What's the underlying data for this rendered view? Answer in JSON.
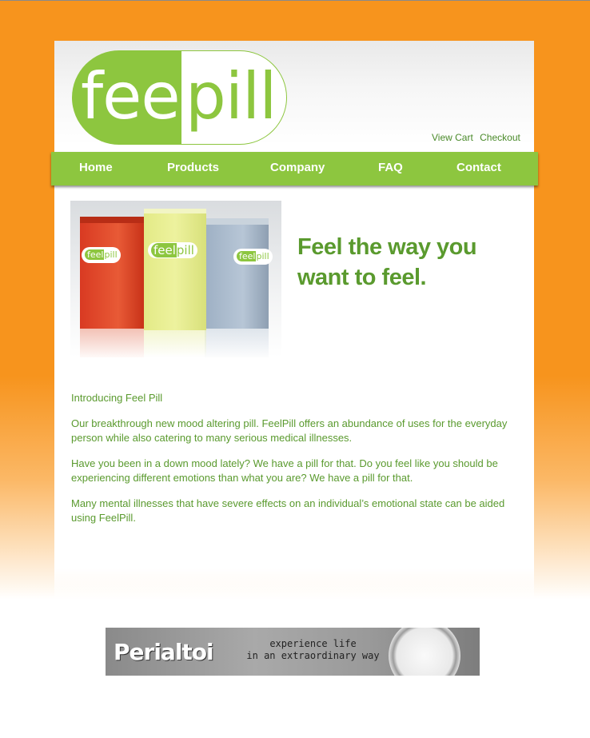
{
  "logo": {
    "part1": "feel",
    "part2": "pill"
  },
  "cart_links": {
    "view_cart": "View Cart",
    "checkout": "Checkout"
  },
  "nav": [
    {
      "label": "Home"
    },
    {
      "label": "Products"
    },
    {
      "label": "Company"
    },
    {
      "label": "FAQ"
    },
    {
      "label": "Contact"
    }
  ],
  "hero": {
    "product_tag": "feelpill",
    "headline_line1": "Feel the way you",
    "headline_line2": "want to feel."
  },
  "content": {
    "intro_heading": "Introducing Feel Pill",
    "paragraphs": [
      "Our breakthrough new mood altering pill. FeelPill offers an abundance of uses for the everyday person while also catering to many serious medical illnesses.",
      "Have you been in a down mood lately? We have a pill for that. Do you feel like you should be experiencing different emotions than what you are? We have a pill for that.",
      "Many mental illnesses that have severe effects on an individual’s emotional state can be aided using FeelPill."
    ]
  },
  "banner": {
    "brand": "Perialtoi",
    "tagline_line1": "experience life",
    "tagline_line2": "in an extraordinary way"
  },
  "colors": {
    "background": "#f7941d",
    "brand_green": "#8dc63f",
    "text_green": "#5a9a2e"
  }
}
